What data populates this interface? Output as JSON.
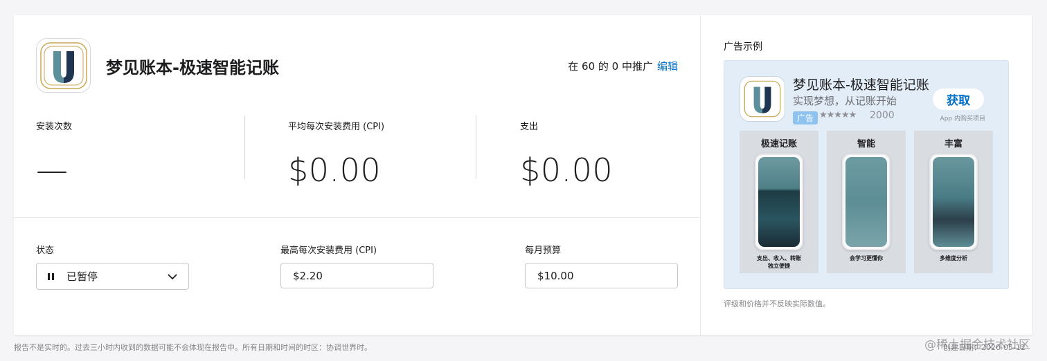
{
  "app": {
    "name": "梦见账本-极速智能记账",
    "icon": "u-logo-icon",
    "promo_text": "在 60 的 0 中推广",
    "edit_label": "编辑"
  },
  "stats": {
    "installs_label": "安装次数",
    "installs_value": "—",
    "avg_cpi_label": "平均每次安装费用 (CPI)",
    "avg_cpi_value": "$0.00",
    "spend_label": "支出",
    "spend_value": "$0.00"
  },
  "controls": {
    "status_label": "状态",
    "status_value": "已暂停",
    "max_cpi_label": "最高每次安装费用 (CPI)",
    "max_cpi_value": "$2.20",
    "budget_label": "每月预算",
    "budget_value": "$10.00"
  },
  "ad_preview": {
    "title": "广告示例",
    "app_name": "梦见账本-极速智能记账",
    "subtitle": "实现梦想，从记账开始",
    "badge": "广告",
    "stars": "★★★★★",
    "rating_count": "2000",
    "get_label": "获取",
    "iap_label": "App 内购买项目",
    "screenshots": [
      {
        "title": "极速记账",
        "caption": "支出、收入、转账\n独立便捷"
      },
      {
        "title": "智能",
        "caption": "会学习更懂你"
      },
      {
        "title": "丰富",
        "caption": "多维度分析"
      }
    ],
    "disclaimer": "评级和价格并不反映实际数值。"
  },
  "footer": {
    "note": "报告不是实时的。过去三小时内收到的数据可能不会体现在报告中。所有日期和时间的时区：协调世界时。",
    "created": "创建日期：2020-05-12"
  },
  "watermark": "@稀土掘金技术社区",
  "colors": {
    "accent": "#0070c9",
    "logo_teal": "#5b8f99",
    "logo_navy": "#1f3550",
    "logo_gold": "#c8a752"
  }
}
